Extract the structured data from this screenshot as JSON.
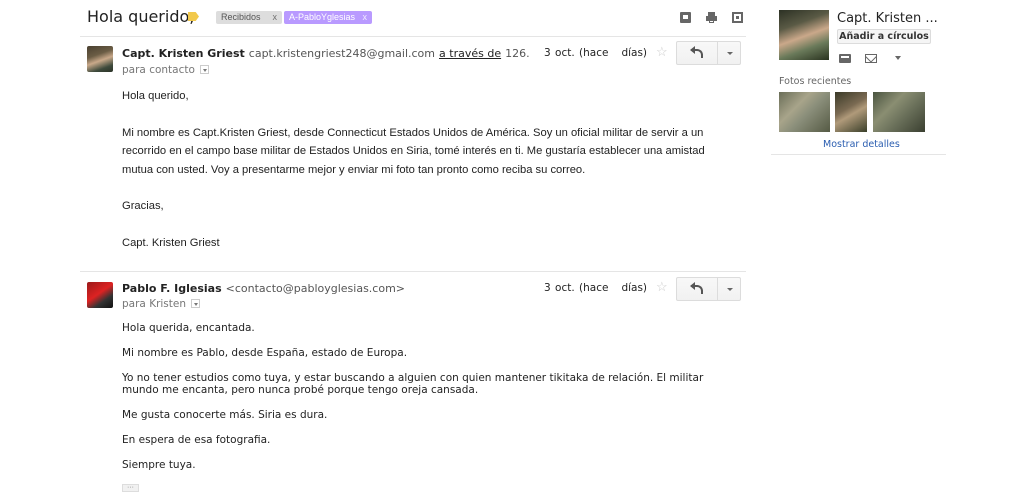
{
  "thread": {
    "subject": "Hola querido,",
    "labels": [
      {
        "text": "Recibidos",
        "remove": "x"
      },
      {
        "text": "A-PabloYglesias",
        "remove": "x"
      }
    ]
  },
  "messages": [
    {
      "sender_name": "Capt. Kristen Griest",
      "sender_email": "capt.kristengriest248@gmail.com",
      "via_text": "a través de",
      "via_ip": "126.",
      "recipient": "para contacto",
      "date": "3 oct. (hace",
      "date_days": "días)",
      "star": "☆",
      "body": [
        "Hola querido,",
        "Mi nombre es Capt.Kristen Griest, desde Connecticut Estados Unidos de América. Soy un oficial militar de servir a un recorrido en el campo base militar de Estados Unidos en Siria, tomé interés en ti. Me gustaría establecer una amistad mutua con usted. Voy a presentarme mejor y enviar mi foto tan pronto como reciba su correo.",
        "Gracias,",
        "Capt. Kristen Griest"
      ]
    },
    {
      "sender_name": "Pablo F. Iglesias",
      "sender_email": "<contacto@pabloyglesias.com>",
      "recipient": "para Kristen",
      "date": "3 oct. (hace",
      "date_days": "días)",
      "star": "☆",
      "body": [
        "Hola querida, encantada.",
        "Mi nombre es Pablo, desde España, estado de Europa.",
        "Yo no tener estudios como tuya, y estar buscando a alguien con quien mantener tikitaka de relación. El militar mundo me encanta, pero nunca probé porque tengo oreja cansada.",
        "Me gusta conocerte más. Siria es dura.",
        "En espera de esa fotografia.",
        "Siempre tuya."
      ],
      "ellipsis": "···"
    }
  ],
  "sidebar": {
    "contact_name": "Capt. Kristen ...",
    "add_circles_label": "Añadir a círculos",
    "recent_photos_title": "Fotos recientes",
    "show_details_label": "Mostrar detalles"
  },
  "colors": {
    "label_custom": "#b99aff",
    "link": "#2a5db0",
    "importance": "#f2c94c"
  }
}
